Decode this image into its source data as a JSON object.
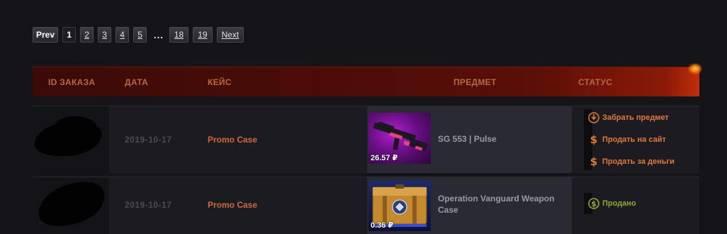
{
  "pagination": {
    "prev": "Prev",
    "pages": [
      "1",
      "2",
      "3",
      "4",
      "5"
    ],
    "ellipsis": "...",
    "end_pages": [
      "18",
      "19"
    ],
    "next": "Next",
    "current": "1"
  },
  "table": {
    "headers": {
      "id": "ID ЗАКАЗА",
      "date": "ДАТА",
      "case": "КЕЙС",
      "item": "ПРЕДМЕТ",
      "status": "СТАТУС"
    },
    "rows": [
      {
        "date": "2019-10-17",
        "case": "Promo Case",
        "item_name": "SG 553 | Pulse",
        "price": "26.57 ₽",
        "actions": {
          "take": "Забрать предмет",
          "sell_site": "Продать на сайт",
          "sell_money": "Продать за деньги"
        }
      },
      {
        "date": "2019-10-17",
        "case": "Promo Case",
        "item_name": "Operation Vanguard Weapon Case",
        "price": "0.36 ₽",
        "status": "Продано"
      }
    ]
  },
  "colors": {
    "accent": "#e07a3a",
    "sold": "#8fa92f",
    "header_bg": "#4a0c08"
  },
  "icons": {
    "take": "download-arrow-icon",
    "sell_site": "dollar-icon",
    "sell_money": "dollar-icon",
    "sold": "dollar-circle-icon"
  }
}
